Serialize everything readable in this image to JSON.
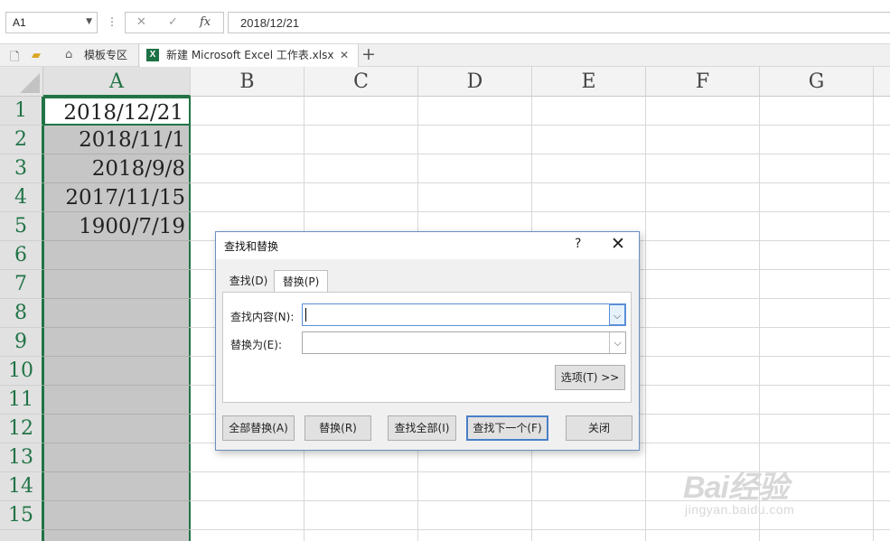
{
  "formula_bar": {
    "name_box": "A1",
    "cancel_icon": "✕",
    "enter_icon": "✓",
    "fx_label": "fx",
    "formula": "2018/12/21"
  },
  "tabs": {
    "template_zone": "模板专区",
    "file_tab": "新建 Microsoft Excel 工作表.xlsx",
    "close_icon": "✕",
    "add_icon": "+"
  },
  "grid": {
    "columns": [
      "A",
      "B",
      "C",
      "D",
      "E",
      "F",
      "G"
    ],
    "rows": [
      "1",
      "2",
      "3",
      "4",
      "5",
      "6",
      "7",
      "8",
      "9",
      "10",
      "11",
      "12",
      "13",
      "14",
      "15"
    ],
    "column_a_values": [
      "2018/12/21",
      "2018/11/1",
      "2018/9/8",
      "2017/11/15",
      "1900/7/19"
    ]
  },
  "dialog": {
    "title": "查找和替换",
    "help": "?",
    "close": "✕",
    "tab_find": "查找(D)",
    "tab_replace": "替换(P)",
    "find_label": "查找内容(N):",
    "find_value": "",
    "replace_label": "替换为(E):",
    "replace_value": "",
    "options_button": "选项(T) >>",
    "replace_all": "全部替换(A)",
    "replace": "替换(R)",
    "find_all": "查找全部(I)",
    "find_next": "查找下一个(F)",
    "close_button": "关闭"
  },
  "watermark": {
    "brand": "Bai经验",
    "url": "jingyan.baidu.com"
  },
  "colors": {
    "excel_green": "#217346",
    "selection_gray": "#c6c6c6",
    "dialog_border": "#6b8fc0"
  }
}
